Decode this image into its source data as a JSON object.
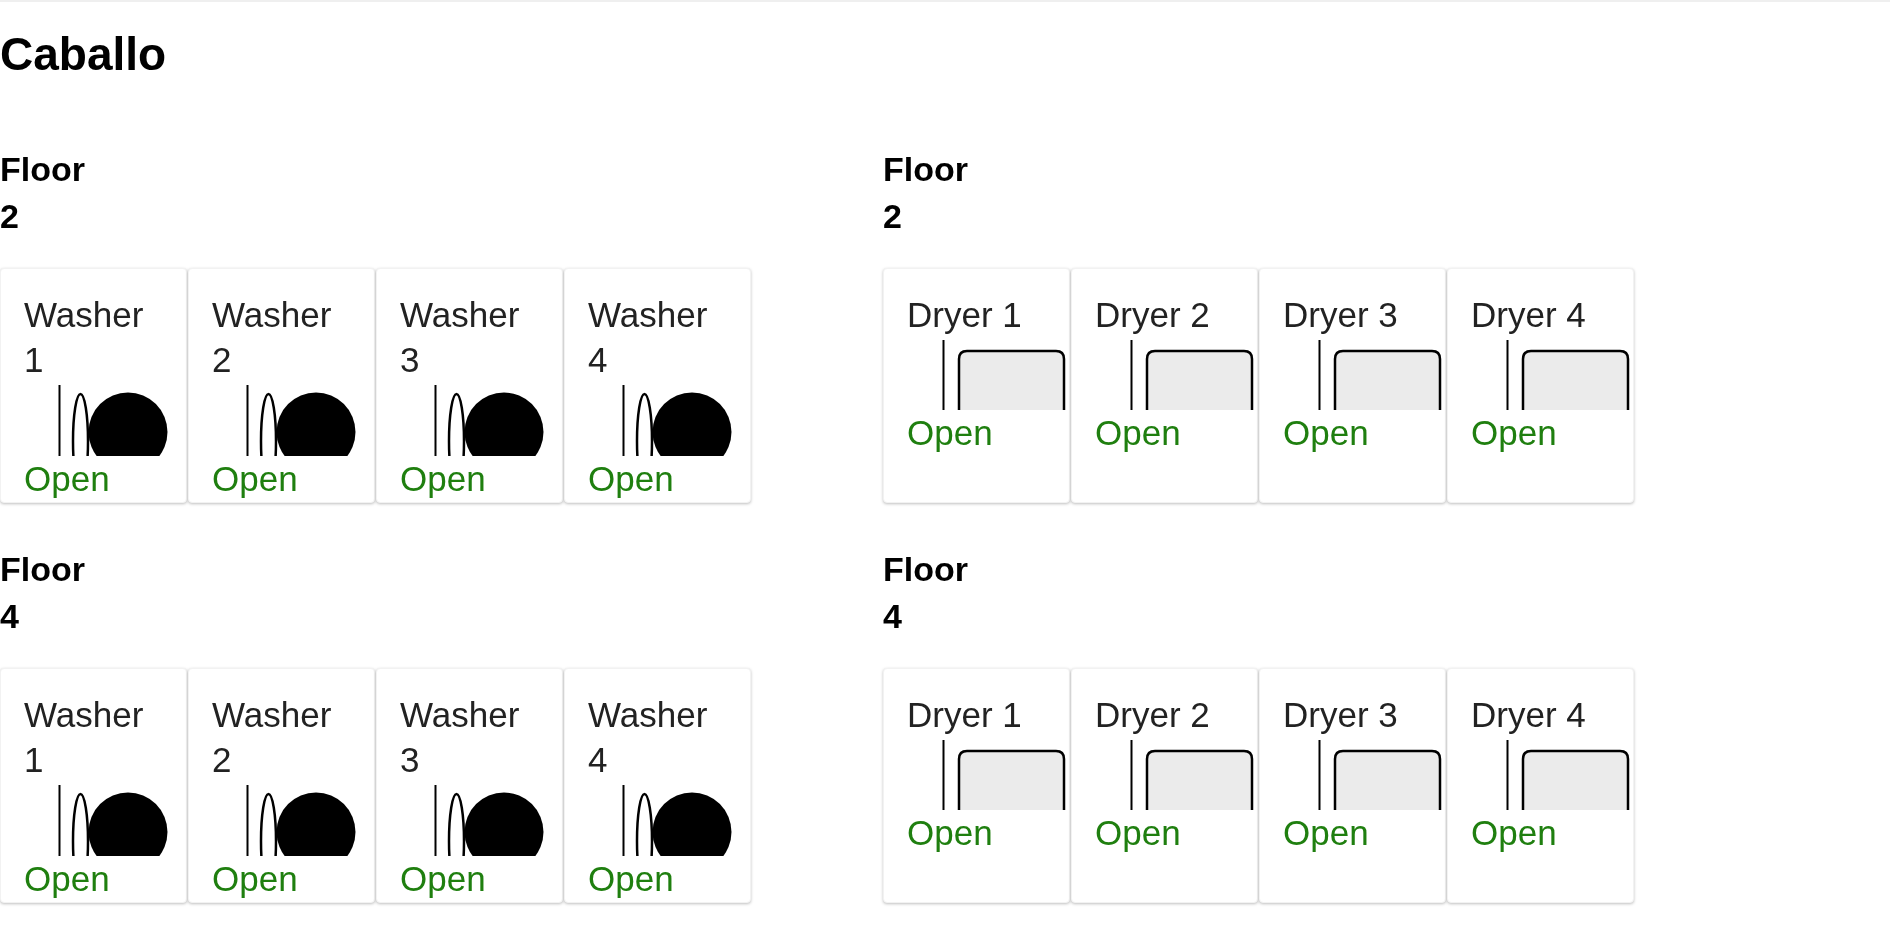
{
  "title": "Caballo",
  "columns": [
    {
      "kind": "washer",
      "floors": [
        {
          "label": "Floor 2",
          "machines": [
            {
              "name": "Washer 1",
              "status": "Open"
            },
            {
              "name": "Washer 2",
              "status": "Open"
            },
            {
              "name": "Washer 3",
              "status": "Open"
            },
            {
              "name": "Washer 4",
              "status": "Open"
            }
          ]
        },
        {
          "label": "Floor 4",
          "machines": [
            {
              "name": "Washer 1",
              "status": "Open"
            },
            {
              "name": "Washer 2",
              "status": "Open"
            },
            {
              "name": "Washer 3",
              "status": "Open"
            },
            {
              "name": "Washer 4",
              "status": "Open"
            }
          ]
        }
      ]
    },
    {
      "kind": "dryer",
      "floors": [
        {
          "label": "Floor 2",
          "machines": [
            {
              "name": "Dryer 1",
              "status": "Open"
            },
            {
              "name": "Dryer 2",
              "status": "Open"
            },
            {
              "name": "Dryer 3",
              "status": "Open"
            },
            {
              "name": "Dryer 4",
              "status": "Open"
            }
          ]
        },
        {
          "label": "Floor 4",
          "machines": [
            {
              "name": "Dryer 1",
              "status": "Open"
            },
            {
              "name": "Dryer 2",
              "status": "Open"
            },
            {
              "name": "Dryer 3",
              "status": "Open"
            },
            {
              "name": "Dryer 4",
              "status": "Open"
            }
          ]
        }
      ]
    }
  ]
}
